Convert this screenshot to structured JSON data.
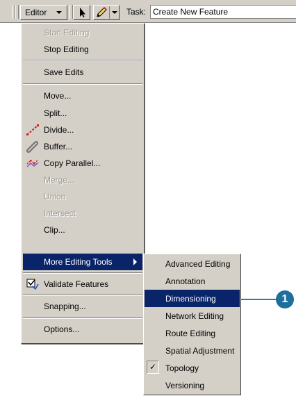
{
  "toolbar": {
    "editor_label": "Editor",
    "editor_mnemonic": "r",
    "task_label": "Task:",
    "task_value": "Create New Feature"
  },
  "menu": {
    "start_editing": "Start Editing",
    "stop_editing": "Stop Editing",
    "save_edits": "Save Edits",
    "move": "Move...",
    "split": "Split...",
    "divide": "Divide...",
    "buffer": "Buffer...",
    "copy_parallel": "Copy Parallel...",
    "merge": "Merge...",
    "union": "Union",
    "intersect": "Intersect",
    "clip": "Clip...",
    "more_editing_tools": "More Editing Tools",
    "validate_features": "Validate Features",
    "snapping": "Snapping...",
    "options": "Options..."
  },
  "submenu": {
    "items": [
      {
        "label": "Advanced Editing",
        "checked": false
      },
      {
        "label": "Annotation",
        "checked": false
      },
      {
        "label": "Dimensioning",
        "checked": false,
        "highlighted": true
      },
      {
        "label": "Network Editing",
        "checked": false
      },
      {
        "label": "Route Editing",
        "checked": false
      },
      {
        "label": "Spatial Adjustment",
        "checked": false
      },
      {
        "label": "Topology",
        "checked": true
      },
      {
        "label": "Versioning",
        "checked": false
      }
    ]
  },
  "callout": "1",
  "colors": {
    "menu_bg": "#d4d0c8",
    "highlight": "#0a246a",
    "callout": "#1d6f9e"
  },
  "icons": [
    "arrow-cursor-icon",
    "pencil-icon",
    "divide-icon",
    "buffer-icon",
    "copy-parallel-icon",
    "validate-features-icon",
    "submenu-arrow-icon",
    "check-icon"
  ]
}
